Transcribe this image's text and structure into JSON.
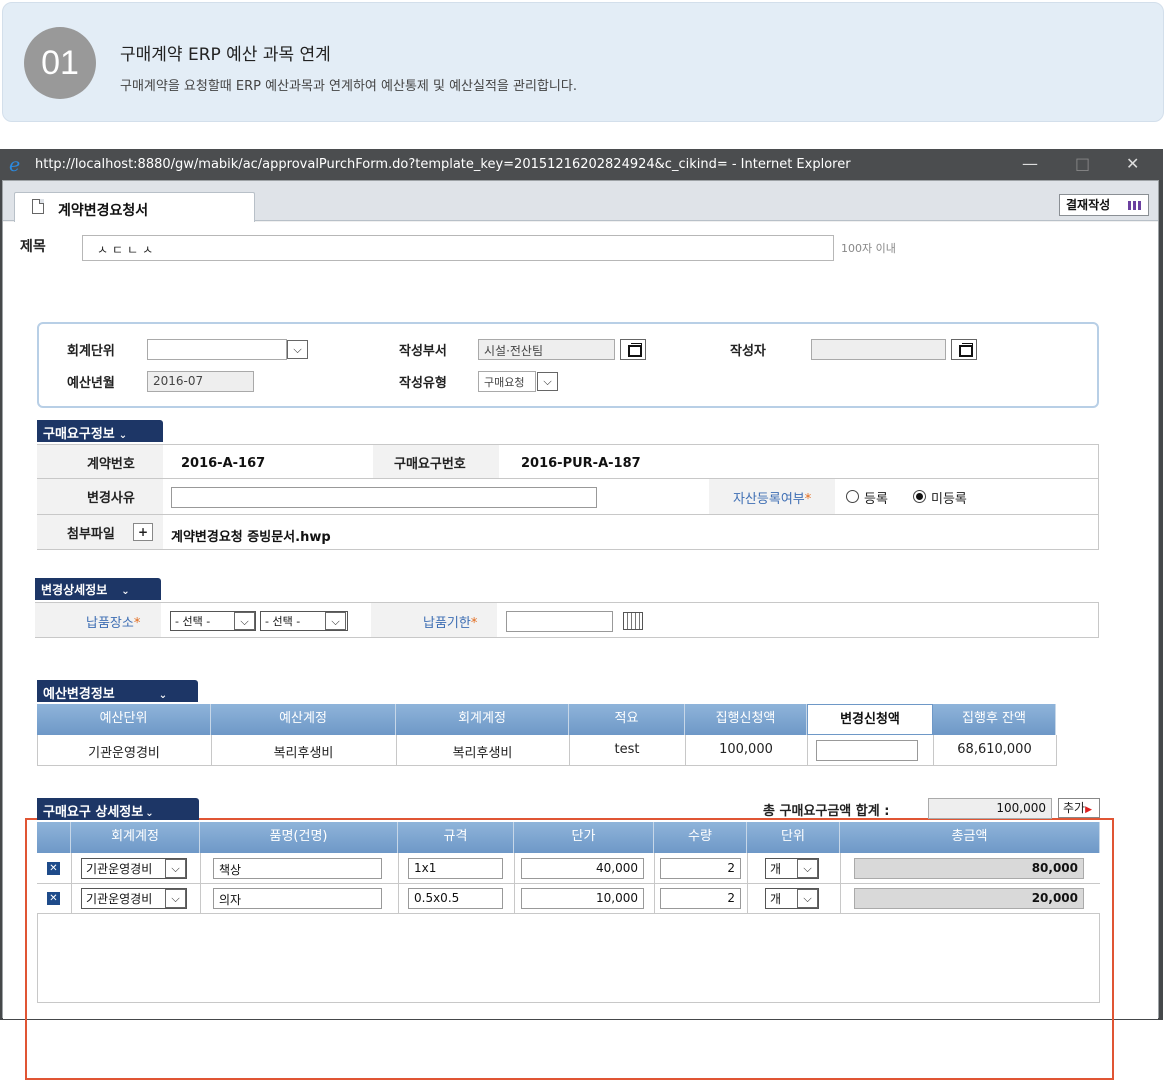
{
  "intro": {
    "number": "01",
    "title": "구매계약 ERP 예산 과목 연계",
    "subtitle": "구매계약을 요청할때 ERP 예산과목과 연계하여 예산통제 및 예산실적을 관리합니다."
  },
  "window": {
    "title": "http://localhost:8880/gw/mabik/ac/approvalPurchForm.do?template_key=20151216202824924&c_cikind= - Internet Explorer",
    "minimize": "—",
    "maximize": "□",
    "close": "✕"
  },
  "tab": {
    "label": "계약변경요청서"
  },
  "approve_button": "결재작성",
  "subject": {
    "label": "제목",
    "value": "ㅅㄷㄴㅅ",
    "hint": "100자 이내"
  },
  "search": {
    "unit_label": "회계단위",
    "unit_value": "",
    "dept_label": "작성부서",
    "dept_value": "시설·전산팀",
    "writer_label": "작성자",
    "writer_value": "",
    "budget_month_label": "예산년월",
    "budget_month_value": "2016-07",
    "type_label": "작성유형",
    "type_value": "구매요청"
  },
  "purchase_info": {
    "header": "구매요구정보",
    "contract_no_label": "계약번호",
    "contract_no": "2016-A-167",
    "request_no_label": "구매요구번호",
    "request_no": "2016-PUR-A-187",
    "reason_label": "변경사유",
    "reason_value": "",
    "asset_label": "자산등록여부",
    "asset_options": [
      "등록",
      "미등록"
    ],
    "asset_selected": "미등록",
    "attach_label": "첨부파일",
    "attach_button": "+",
    "attach_file": "계약변경요청 증빙문서.hwp"
  },
  "change_detail": {
    "header": "변경상세정보",
    "place_label": "납품장소",
    "select1": "- 선택 -",
    "select2": "- 선택 -",
    "deadline_label": "납품기한",
    "deadline_value": ""
  },
  "budget_change": {
    "header": "예산변경정보",
    "columns": [
      "예산단위",
      "예산계정",
      "회계계정",
      "적요",
      "집행신청액",
      "변경신청액",
      "집행후 잔액"
    ],
    "row": [
      "기관운영경비",
      "복리후생비",
      "복리후생비",
      "test",
      "100,000",
      "",
      "68,610,000"
    ]
  },
  "purchase_detail": {
    "header": "구매요구 상세정보",
    "total_label": "총 구매요구금액 합계 :",
    "total_value": "100,000",
    "add_button": "추가",
    "columns": [
      "회계계정",
      "품명(건명)",
      "규격",
      "단가",
      "수량",
      "단위",
      "총금액"
    ],
    "rows": [
      {
        "account": "기관운영경비",
        "item": "책상",
        "spec": "1x1",
        "price": "40,000",
        "qty": "2",
        "unit": "개",
        "total": "80,000"
      },
      {
        "account": "기관운영경비",
        "item": "의자",
        "spec": "0.5x0.5",
        "price": "10,000",
        "qty": "2",
        "unit": "개",
        "total": "20,000"
      }
    ]
  },
  "colors": {
    "section_header": "#1d3666",
    "grid_header": "#7ea6d0",
    "highlight": "#e05534"
  }
}
